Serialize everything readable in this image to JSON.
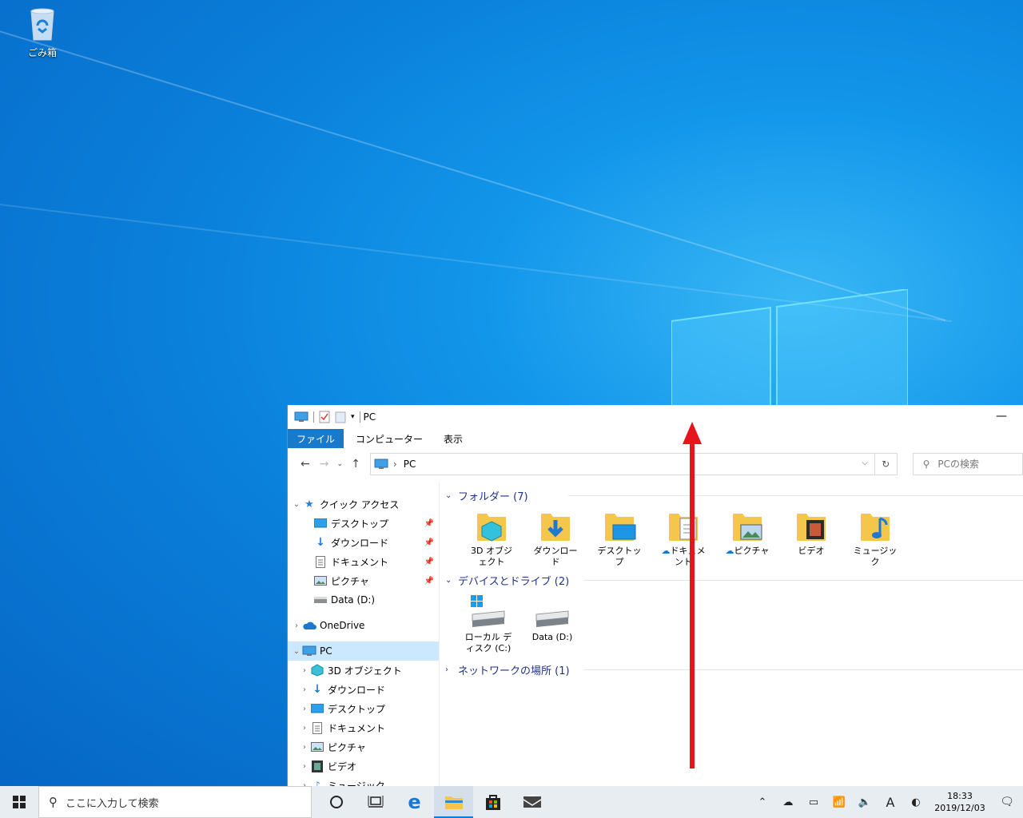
{
  "desktop": {
    "recycle_bin_label": "ごみ箱"
  },
  "explorer": {
    "title": "PC",
    "ribbon_tabs": [
      "ファイル",
      "コンピューター",
      "表示"
    ],
    "address": "PC",
    "search_placeholder": "PCの検索",
    "nav": {
      "quick_access": "クイック アクセス",
      "quick_items": [
        "デスクトップ",
        "ダウンロード",
        "ドキュメント",
        "ピクチャ",
        "Data (D:)"
      ],
      "onedrive": "OneDrive",
      "pc": "PC",
      "pc_items": [
        "3D オブジェクト",
        "ダウンロード",
        "デスクトップ",
        "ドキュメント",
        "ピクチャ",
        "ビデオ",
        "ミュージック"
      ]
    },
    "groups": {
      "folders_header": "フォルダー (7)",
      "folders": [
        "3D オブジェクト",
        "ダウンロード",
        "デスクトップ",
        "ドキュメント",
        "ピクチャ",
        "ビデオ",
        "ミュージック"
      ],
      "devices_header": "デバイスとドライブ (2)",
      "drives": [
        "ローカル ディスク (C:)",
        "Data (D:)"
      ],
      "network_header": "ネットワークの場所 (1)"
    }
  },
  "taskbar": {
    "search_placeholder": "ここに入力して検索",
    "ime_indicator": "A",
    "time": "18:33",
    "date": "2019/12/03"
  },
  "annotation": {
    "arrow_color": "#e8141c",
    "direction": "up"
  },
  "colors": {
    "accent": "#1979ca",
    "selection": "#cce8ff",
    "group_header": "#1e3287",
    "folder": "#f4c74a"
  }
}
